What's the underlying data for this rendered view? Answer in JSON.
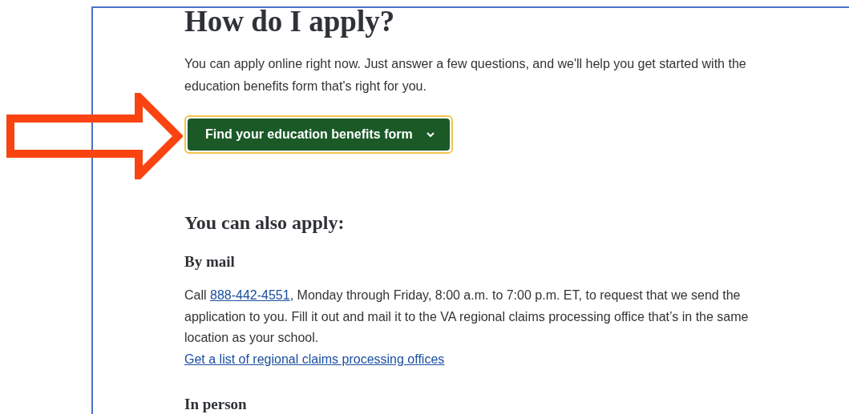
{
  "heading": "How do I apply?",
  "intro": "You can apply online right now. Just answer a few questions, and we'll help you get started with the education benefits form that's right for you.",
  "button": {
    "label": "Find your education benefits form",
    "focused": true
  },
  "also_heading": "You can also apply:",
  "sections": [
    {
      "heading": "By mail",
      "text_before": "Call ",
      "phone": "888-442-4551",
      "text_after": ", Monday through Friday, 8:00 a.m. to 7:00 p.m. ET, to request that we send the application to you. Fill it out and mail it to the VA regional claims processing office that’s in the same location as your school.",
      "link": "Get a list of regional claims processing offices"
    },
    {
      "heading": "In person"
    }
  ]
}
